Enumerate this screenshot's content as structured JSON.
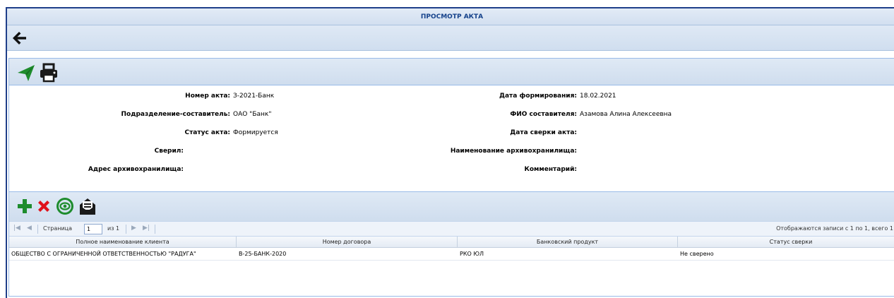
{
  "window": {
    "title": "ПРОСМОТР АКТА"
  },
  "icons": {
    "back": "arrow-left-icon",
    "send": "paper-plane-icon",
    "print": "printer-icon",
    "add": "plus-icon",
    "delete": "x-icon",
    "view": "eye-icon",
    "envelope": "envelope-open-icon"
  },
  "colors": {
    "accent": "#15428b",
    "green": "#1e8c2d",
    "red": "#e0121b",
    "dark_icon": "#1a1a1a"
  },
  "form": {
    "left": [
      {
        "label": "Номер акта:",
        "value": "З-2021-Банк"
      },
      {
        "label": "Подразделение-составитель:",
        "value": "ОАО \"Банк\""
      },
      {
        "label": "Статус акта:",
        "value": "Формируется"
      },
      {
        "label": "Сверил:",
        "value": ""
      },
      {
        "label": "Адрес архивохранилища:",
        "value": ""
      }
    ],
    "right": [
      {
        "label": "Дата формирования:",
        "value": "18.02.2021"
      },
      {
        "label": "ФИО составителя:",
        "value": "Азамова Алина Алексеевна"
      },
      {
        "label": "Дата сверки акта:",
        "value": ""
      },
      {
        "label": "Наименование архивохранилища:",
        "value": ""
      },
      {
        "label": "Комментарий:",
        "value": ""
      }
    ]
  },
  "pager": {
    "page_label": "Страница",
    "page_value": "1",
    "of_label": "из 1",
    "summary": "Отображаются записи с 1 по 1, всего 1"
  },
  "grid": {
    "columns": [
      "Полное наименование клиента",
      "Номер договора",
      "Банковский продукт",
      "Статус сверки"
    ],
    "rows": [
      [
        "ОБЩЕСТВО С ОГРАНИЧЕННОЙ ОТВЕТСТВЕННОСТЬЮ \"РАДУГА\"",
        "В-25-БАНК-2020",
        "РКО ЮЛ",
        "Не сверено"
      ]
    ]
  }
}
